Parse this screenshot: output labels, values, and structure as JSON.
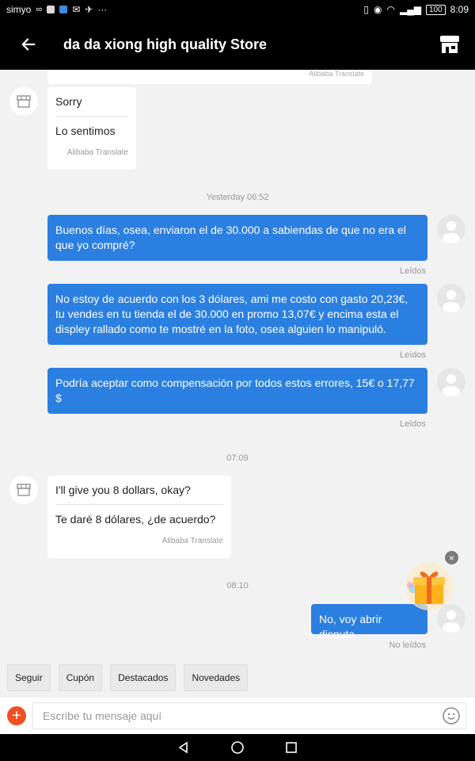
{
  "status_bar": {
    "carrier": "simyo",
    "battery": "100",
    "time": "8:09"
  },
  "header": {
    "store_name": "da da xiong high quality Store"
  },
  "messages": {
    "top_partial_credit": "Alibaba Translate",
    "m1": {
      "original": "Sorry",
      "translated": "Lo sentimos",
      "credit": "Alibaba Translate"
    },
    "ts1": "Yesterday 06:52",
    "m2": {
      "text": "Buenos días, osea, enviaron el de 30.000 a sabiendas de que no era el que yo compré?",
      "status": "Leídos"
    },
    "m3": {
      "text": "No estoy de acuerdo con los 3 dólares, ami me costo con gasto 20,23€, tu vendes en tu tienda el de 30.000 en promo 13,07€ y encima esta el displey rallado como te mostré en la foto, osea alguien lo manipuló.",
      "status": "Leídos"
    },
    "m4": {
      "text": "Podría aceptar como compensación por todos estos errores, 15€ o 17,77 $",
      "status": "Leídos"
    },
    "ts2": "07:09",
    "m5": {
      "original": "I'll give you 8 dollars, okay?",
      "translated": "Te daré 8 dólares, ¿de acuerdo?",
      "credit": "Alibaba Translate"
    },
    "ts3": "08:10",
    "m6": {
      "text": "No, voy abrir disputa",
      "status": "No leídos"
    }
  },
  "quick_actions": {
    "follow": "Seguir",
    "coupon": "Cupón",
    "featured": "Destacados",
    "new": "Novedades"
  },
  "composer": {
    "placeholder": "Escribe tu mensaje aquí"
  },
  "colors": {
    "sent_bubble": "#2b7fe0",
    "add_button": "#f04e23",
    "app_bar": "#000000"
  }
}
